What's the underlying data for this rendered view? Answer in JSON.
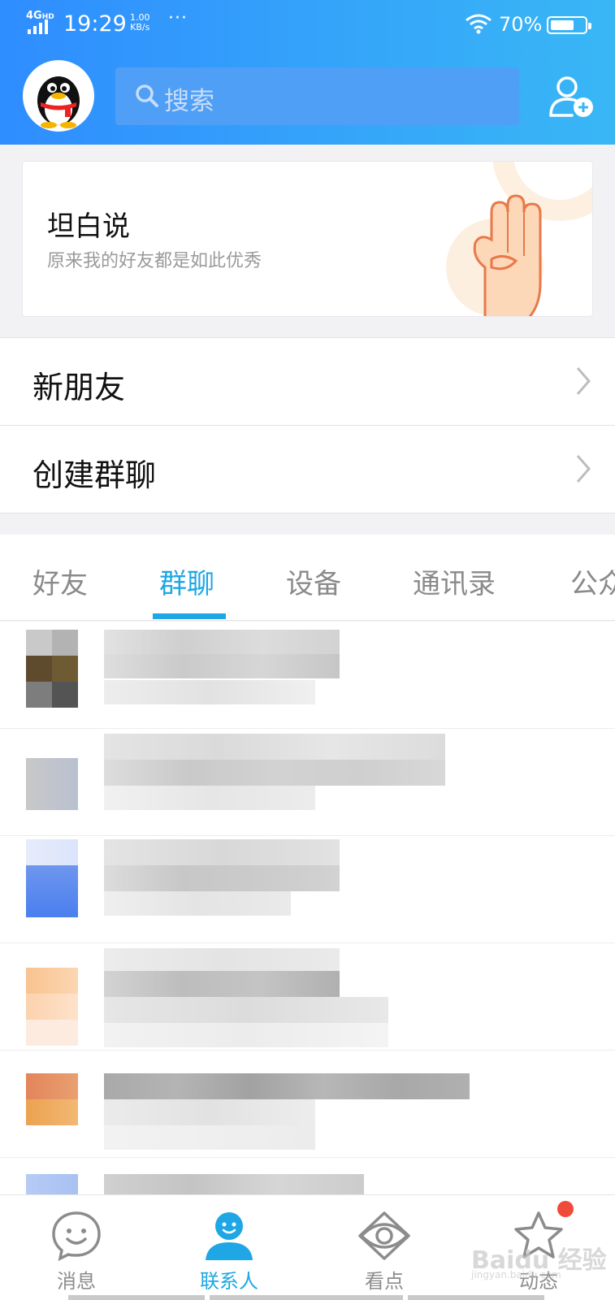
{
  "status_bar": {
    "network": "4G",
    "network_suffix": "HD",
    "time": "19:29",
    "speed_value": "1.00",
    "speed_unit": "KB/s",
    "more": "···",
    "battery_text": "70%",
    "battery_level": 0.7
  },
  "header": {
    "search_placeholder": "搜索",
    "avatar_icon": "qq-penguin-icon",
    "add_icon": "add-contact-icon"
  },
  "banner": {
    "title": "坦白说",
    "subtitle": "原来我的好友都是如此优秀",
    "art_icon": "three-fingers-hand-icon"
  },
  "menu": {
    "new_friends": "新朋友",
    "create_group": "创建群聊"
  },
  "tabs": [
    {
      "label": "好友",
      "active": false
    },
    {
      "label": "群聊",
      "active": true
    },
    {
      "label": "设备",
      "active": false
    },
    {
      "label": "通讯录",
      "active": false
    },
    {
      "label": "公众号",
      "active": false
    }
  ],
  "bottom_nav": [
    {
      "label": "消息",
      "icon": "smile-chat-icon",
      "active": false
    },
    {
      "label": "联系人",
      "icon": "person-icon",
      "active": true
    },
    {
      "label": "看点",
      "icon": "eye-icon",
      "active": false
    },
    {
      "label": "动态",
      "icon": "star-icon",
      "active": false,
      "badge": true
    }
  ],
  "watermark": {
    "text": "Baidu 经验",
    "url": "jingyan.baidu.com"
  },
  "colors": {
    "brand_blue": "#2f8dff",
    "accent": "#1ea7e4",
    "badge_red": "#f04a3a"
  }
}
